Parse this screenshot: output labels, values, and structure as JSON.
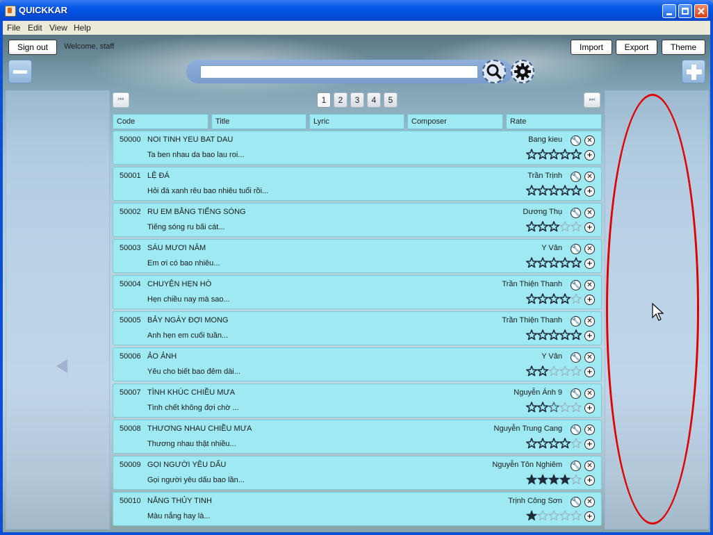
{
  "window": {
    "title": "QUICKKAR"
  },
  "menu": [
    "File",
    "Edit",
    "View",
    "Help"
  ],
  "toolbar": {
    "sign_out": "Sign out",
    "welcome": "Welcome, staff",
    "import": "Import",
    "export": "Export",
    "theme": "Theme"
  },
  "search": {
    "value": "",
    "placeholder": ""
  },
  "pager": {
    "pages": [
      "1",
      "2",
      "3",
      "4",
      "5"
    ],
    "current": "1",
    "first_glyph": "⏮",
    "last_glyph": "⏭"
  },
  "columns": [
    "Code",
    "Title",
    "Lyric",
    "Composer",
    "Rate"
  ],
  "songs": [
    {
      "code": "50000",
      "title": "NOI TINH YEU BAT DAU",
      "lyric": "Ta ben nhau da bao lau roi...",
      "composer": "Bang kieu",
      "rating": 0
    },
    {
      "code": "50001",
      "title": "LỆ ĐÁ",
      "lyric": "Hỏi đá xanh rêu bao nhiêu tuổi rồi...",
      "composer": "Trần Trịnh",
      "rating": 0
    },
    {
      "code": "50002",
      "title": "RU EM BẰNG TIẾNG SÓNG",
      "lyric": "Tiếng sóng ru bãi cát...",
      "composer": "Dương Thụ",
      "rating": 0
    },
    {
      "code": "50003",
      "title": "SÁU MƯƠI NĂM",
      "lyric": "Em ơi có bao nhiêu...",
      "composer": "Y Vân",
      "rating": 0
    },
    {
      "code": "50004",
      "title": "CHUYỆN HẸN HÒ",
      "lyric": "Hẹn chiều nay mà sao...",
      "composer": "Trần Thiện Thanh",
      "rating": 0
    },
    {
      "code": "50005",
      "title": "BẢY NGÀY ĐỢI MONG",
      "lyric": "Anh hẹn em cuối tuần...",
      "composer": "Trần Thiện Thanh",
      "rating": 0
    },
    {
      "code": "50006",
      "title": "ẢO ẢNH",
      "lyric": "Yêu cho biết bao đêm dài...",
      "composer": "Y Vân",
      "rating": 0
    },
    {
      "code": "50007",
      "title": "TÌNH KHÚC CHIỀU MƯA",
      "lyric": "Tình chết không đợi chờ ...",
      "composer": "Nguyễn Ánh 9",
      "rating": 0
    },
    {
      "code": "50008",
      "title": "THƯƠNG NHAU CHIỀU MƯA",
      "lyric": "Thương nhau thật nhiều...",
      "composer": "Nguyễn Trung Cang",
      "rating": 0
    },
    {
      "code": "50009",
      "title": "GỌI NGƯỜI YÊU DẤU",
      "lyric": "Gọi người yêu dấu bao lần...",
      "composer": "Nguyễn Tôn Nghiêm",
      "rating": 4
    },
    {
      "code": "50010",
      "title": "NẮNG THỦY TINH",
      "lyric": "Màu nắng hay là...",
      "composer": "Trịnh Công Sơn",
      "rating": 1
    }
  ],
  "star_outline_counts": [
    5,
    5,
    3,
    5,
    4,
    5,
    2,
    2.5,
    4,
    4,
    1
  ],
  "colors": {
    "row_background": "#9ee9f2",
    "annotation": "#e00000",
    "titlebar": "#0a5ce8"
  },
  "icons": {
    "minimize": "minimize-icon",
    "zoom_out": "minus-icon",
    "zoom_in": "plus-icon",
    "search": "search-icon",
    "settings": "gear-icon",
    "edit": "wrench-icon",
    "delete": "close-icon",
    "add": "plus-circle-icon",
    "prev": "left-arrow-icon"
  }
}
